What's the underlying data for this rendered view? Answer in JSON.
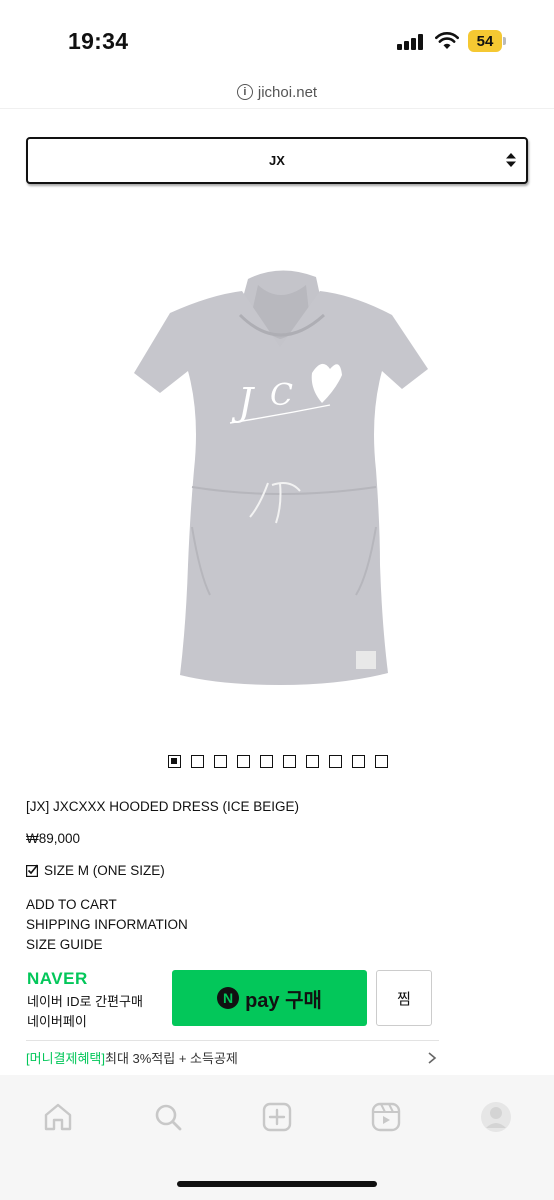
{
  "status_bar": {
    "time": "19:34",
    "battery": "54"
  },
  "url_bar": {
    "domain": "jichoi.net",
    "info_icon": "i"
  },
  "brand_select": {
    "selected": "JX"
  },
  "product": {
    "image_icon": "hooded-dress-image",
    "gallery_total": 10,
    "gallery_active": 1,
    "title": "[JX] JXCXXX HOODED DRESS (ICE BEIGE)",
    "price": "₩89,000",
    "size_option": "SIZE M (ONE SIZE)"
  },
  "links": {
    "add_to_cart": "ADD TO CART",
    "shipping": "SHIPPING INFORMATION",
    "size_guide": "SIZE GUIDE"
  },
  "naver_pay": {
    "logo": "NAVER",
    "desc_line1": "네이버 ID로 간편구매",
    "desc_line2": "네이버페이",
    "n_mark": "N",
    "button_label": "pay 구매",
    "wish_label": "찜",
    "benefit_tag": "[머니결제혜택]",
    "benefit_text": "최대 3%적립 + 소득공제"
  },
  "colors": {
    "naver_green": "#03c75a",
    "battery_yellow": "#f5c832",
    "dress_grey": "#c6c6cc"
  }
}
